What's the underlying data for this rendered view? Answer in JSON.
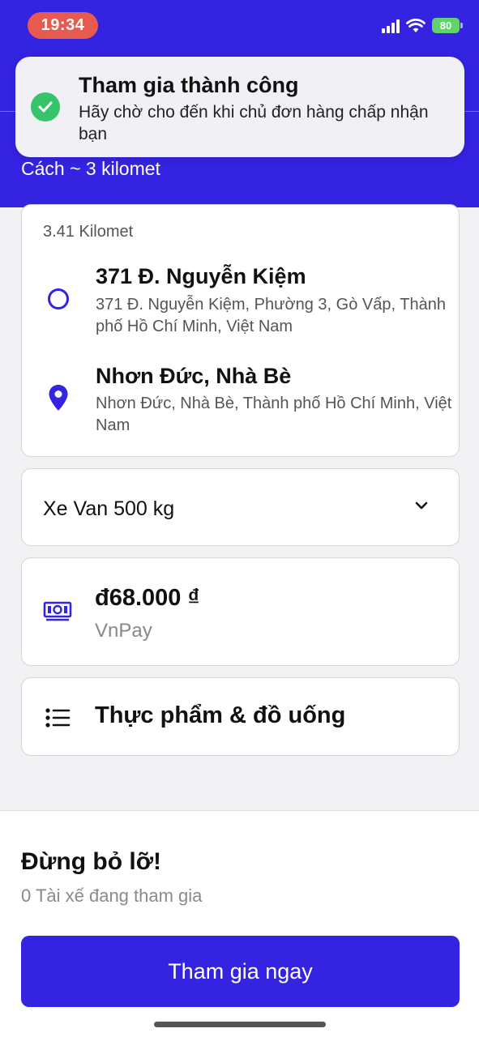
{
  "status_bar": {
    "time": "19:34",
    "battery": "80"
  },
  "toast": {
    "title": "Tham gia thành công",
    "message": "Hãy chờ cho đến khi chủ đơn hàng chấp nhận bạn",
    "icon": "check-circle-icon"
  },
  "header": {
    "distance_hint": "Cách ~ 3 kilomet"
  },
  "route": {
    "distance": "3.41 Kilomet",
    "origin": {
      "title": "371 Đ. Nguyễn Kiệm",
      "address": "371 Đ. Nguyễn Kiệm, Phường 3, Gò Vấp, Thành phố Hồ Chí Minh, Việt Nam"
    },
    "destination": {
      "title": "Nhơn Đức, Nhà Bè",
      "address": "Nhơn Đức, Nhà Bè, Thành phố Hồ Chí Minh, Việt Nam"
    }
  },
  "vehicle": {
    "label": "Xe Van 500 kg"
  },
  "payment": {
    "amount": "đ68.000 ₫",
    "method": "VnPay"
  },
  "goods": {
    "label": "Thực phẩm & đồ uống"
  },
  "cta": {
    "title": "Đừng bỏ lỡ!",
    "subtitle": "0 Tài xế đang tham gia",
    "button_label": "Tham gia ngay"
  },
  "colors": {
    "primary": "#3423e0",
    "success": "#35c46a",
    "status_time_bg": "#e65a50",
    "battery": "#5fd46c"
  }
}
